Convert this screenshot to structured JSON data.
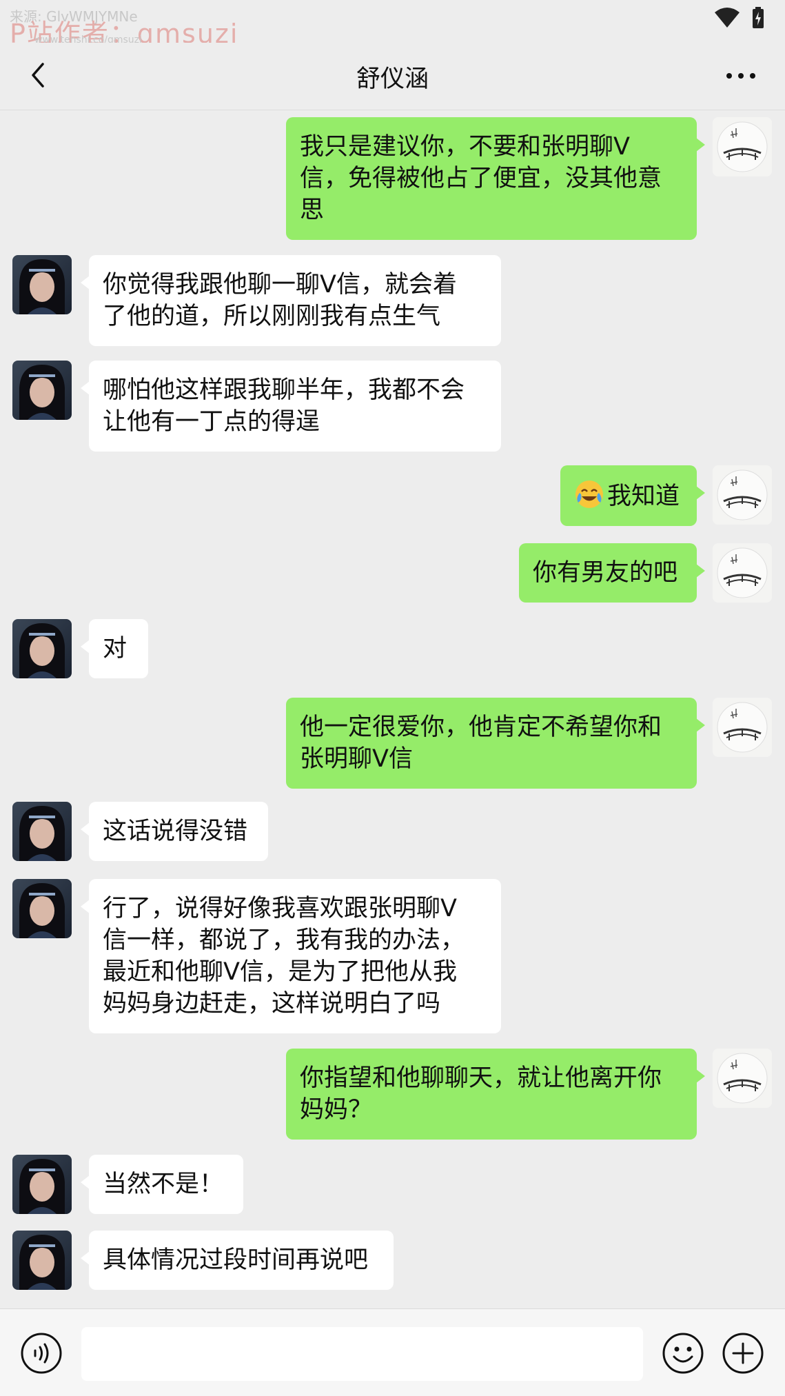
{
  "status_bar": {
    "watermark_top": "来源: GlvWMJYMNe",
    "watermark_main": "P站作者：qmsuzi",
    "watermark_small": "www.tenshi.co/qmsuzi"
  },
  "header": {
    "title": "舒仪涵"
  },
  "colors": {
    "background": "#ededed",
    "outgoing_bubble": "#95ec69",
    "incoming_bubble": "#ffffff"
  },
  "messages": [
    {
      "side": "out",
      "text": "我只是建议你，不要和张明聊V信，免得被他占了便宜，没其他意思",
      "lines": [
        "我只是建议你，不要和张明聊V",
        "信，免得被他占了便宜，没其他意",
        "思"
      ]
    },
    {
      "side": "in",
      "text": "你觉得我跟他聊一聊V信，就会着了他的道，所以刚刚我有点生气",
      "lines": [
        "你觉得我跟他聊一聊V信，就会着",
        "了他的道，所以刚刚我有点生气"
      ]
    },
    {
      "side": "in",
      "text": "哪怕他这样跟我聊半年，我都不会让他有一丁点的得逞",
      "lines": [
        "哪怕他这样跟我聊半年，我都不会",
        "让他有一丁点的得逞"
      ]
    },
    {
      "side": "out",
      "emoji": "crying-laughing-emoji",
      "text": "我知道",
      "lines": [
        "我知道"
      ]
    },
    {
      "side": "out",
      "text": "你有男友的吧",
      "lines": [
        "你有男友的吧"
      ]
    },
    {
      "side": "in",
      "text": "对",
      "lines": [
        "对"
      ]
    },
    {
      "side": "out",
      "text": "他一定很爱你，他肯定不希望你和张明聊V信",
      "lines": [
        "他一定很爱你，他肯定不希望你和",
        "张明聊V信"
      ]
    },
    {
      "side": "in",
      "text": "这话说得没错",
      "lines": [
        "这话说得没错"
      ]
    },
    {
      "side": "in",
      "text": "行了，说得好像我喜欢跟张明聊V信一样，都说了，我有我的办法，最近和他聊V信，是为了把他从我妈妈身边赶走，这样说明白了吗",
      "lines": [
        "行了，说得好像我喜欢跟张明聊V",
        "信一样，都说了，我有我的办法，",
        "最近和他聊V信，是为了把他从我",
        "妈妈身边赶走，这样说明白了吗"
      ]
    },
    {
      "side": "out",
      "text": "你指望和他聊聊天，就让他离开你妈妈？",
      "lines": [
        "你指望和他聊聊天，就让他离开你",
        "妈妈？"
      ]
    },
    {
      "side": "in",
      "text": "当然不是！",
      "lines": [
        "当然不是！"
      ]
    },
    {
      "side": "in",
      "text": "具体情况过段时间再说吧",
      "lines": [
        "具体情况过段时间再说吧"
      ]
    }
  ],
  "input": {
    "value": "",
    "placeholder": ""
  }
}
